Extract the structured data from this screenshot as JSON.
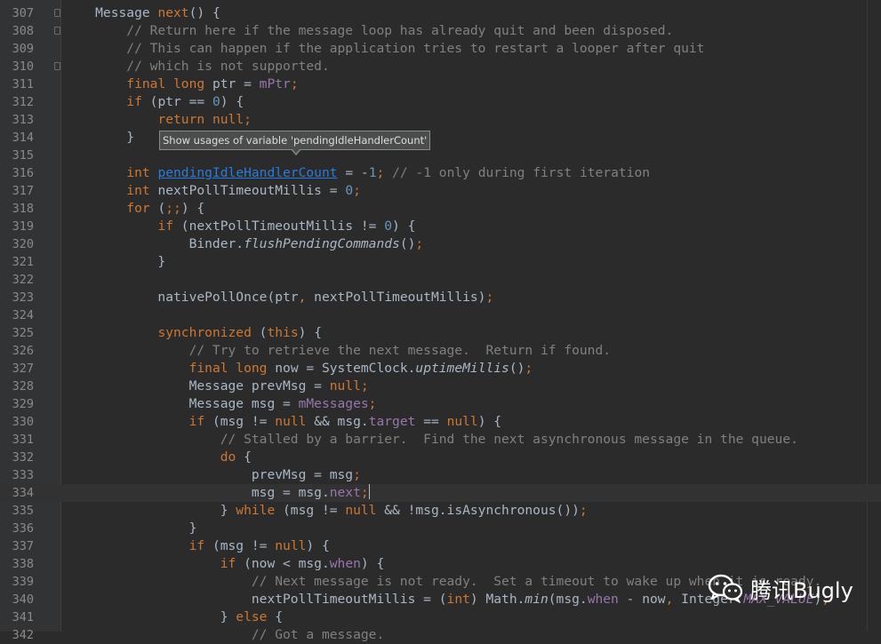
{
  "editor": {
    "lines": [
      {
        "num": "307",
        "fold": true,
        "tokens": [
          [
            "",
            "    Message "
          ],
          [
            "kw",
            "next"
          ],
          [
            "",
            "() {"
          ]
        ]
      },
      {
        "num": "308",
        "fold": true,
        "tokens": [
          [
            "cm",
            "        // Return here if the message loop has already quit and been disposed."
          ]
        ]
      },
      {
        "num": "309",
        "fold": false,
        "tokens": [
          [
            "cm",
            "        // This can happen if the application tries to restart a looper after quit"
          ]
        ]
      },
      {
        "num": "310",
        "fold": true,
        "tokens": [
          [
            "cm",
            "        // which is not supported."
          ]
        ]
      },
      {
        "num": "311",
        "fold": false,
        "tokens": [
          [
            "",
            "        "
          ],
          [
            "kw",
            "final long "
          ],
          [
            "",
            "ptr = "
          ],
          [
            "fld",
            "mPtr"
          ],
          [
            "kw",
            ";"
          ]
        ]
      },
      {
        "num": "312",
        "fold": false,
        "tokens": [
          [
            "",
            "        "
          ],
          [
            "kw",
            "if "
          ],
          [
            "",
            "(ptr == "
          ],
          [
            "nm",
            "0"
          ],
          [
            "",
            ") {"
          ]
        ]
      },
      {
        "num": "313",
        "fold": false,
        "tokens": [
          [
            "",
            "            "
          ],
          [
            "kw",
            "return null;"
          ]
        ]
      },
      {
        "num": "314",
        "fold": false,
        "tokens": [
          [
            "",
            "        }"
          ]
        ]
      },
      {
        "num": "315",
        "fold": false,
        "tokens": []
      },
      {
        "num": "316",
        "fold": false,
        "tokens": [
          [
            "",
            "        "
          ],
          [
            "kw",
            "int "
          ],
          [
            "link",
            "pendingIdleHandlerCount"
          ],
          [
            "",
            " = -"
          ],
          [
            "nm",
            "1"
          ],
          [
            "kw",
            "; "
          ],
          [
            "cm",
            "// -1 only during first iteration"
          ]
        ]
      },
      {
        "num": "317",
        "fold": false,
        "tokens": [
          [
            "",
            "        "
          ],
          [
            "kw",
            "int "
          ],
          [
            "",
            "nextPollTimeoutMillis = "
          ],
          [
            "nm",
            "0"
          ],
          [
            "kw",
            ";"
          ]
        ]
      },
      {
        "num": "318",
        "fold": false,
        "tokens": [
          [
            "",
            "        "
          ],
          [
            "kw",
            "for "
          ],
          [
            "",
            "("
          ],
          [
            "kw",
            ";;"
          ],
          [
            "",
            ") {"
          ]
        ]
      },
      {
        "num": "319",
        "fold": false,
        "tokens": [
          [
            "",
            "            "
          ],
          [
            "kw",
            "if "
          ],
          [
            "",
            "(nextPollTimeoutMillis != "
          ],
          [
            "nm",
            "0"
          ],
          [
            "",
            ") {"
          ]
        ]
      },
      {
        "num": "320",
        "fold": false,
        "tokens": [
          [
            "",
            "                Binder."
          ],
          [
            "it",
            "flushPendingCommands"
          ],
          [
            "",
            "()"
          ],
          [
            "kw",
            ";"
          ]
        ]
      },
      {
        "num": "321",
        "fold": false,
        "tokens": [
          [
            "",
            "            }"
          ]
        ]
      },
      {
        "num": "322",
        "fold": false,
        "tokens": []
      },
      {
        "num": "323",
        "fold": false,
        "tokens": [
          [
            "",
            "            nativePollOnce(ptr"
          ],
          [
            "kw",
            ", "
          ],
          [
            "",
            "nextPollTimeoutMillis)"
          ],
          [
            "kw",
            ";"
          ]
        ]
      },
      {
        "num": "324",
        "fold": false,
        "tokens": []
      },
      {
        "num": "325",
        "fold": false,
        "tokens": [
          [
            "",
            "            "
          ],
          [
            "kw",
            "synchronized "
          ],
          [
            "",
            "("
          ],
          [
            "kw",
            "this"
          ],
          [
            "",
            ") {"
          ]
        ]
      },
      {
        "num": "326",
        "fold": false,
        "tokens": [
          [
            "cm",
            "                // Try to retrieve the next message.  Return if found."
          ]
        ]
      },
      {
        "num": "327",
        "fold": false,
        "tokens": [
          [
            "",
            "                "
          ],
          [
            "kw",
            "final long "
          ],
          [
            "",
            "now = SystemClock."
          ],
          [
            "it",
            "uptimeMillis"
          ],
          [
            "",
            "()"
          ],
          [
            "kw",
            ";"
          ]
        ]
      },
      {
        "num": "328",
        "fold": false,
        "tokens": [
          [
            "",
            "                Message prevMsg = "
          ],
          [
            "kw",
            "null;"
          ]
        ]
      },
      {
        "num": "329",
        "fold": false,
        "tokens": [
          [
            "",
            "                Message msg = "
          ],
          [
            "fld",
            "mMessages"
          ],
          [
            "kw",
            ";"
          ]
        ]
      },
      {
        "num": "330",
        "fold": false,
        "tokens": [
          [
            "",
            "                "
          ],
          [
            "kw",
            "if "
          ],
          [
            "",
            "(msg != "
          ],
          [
            "kw",
            "null "
          ],
          [
            "",
            "&& msg."
          ],
          [
            "fld",
            "target "
          ],
          [
            "",
            "== "
          ],
          [
            "kw",
            "null"
          ],
          [
            "",
            ") {"
          ]
        ]
      },
      {
        "num": "331",
        "fold": false,
        "tokens": [
          [
            "cm",
            "                    // Stalled by a barrier.  Find the next asynchronous message in the queue."
          ]
        ]
      },
      {
        "num": "332",
        "fold": false,
        "tokens": [
          [
            "",
            "                    "
          ],
          [
            "kw",
            "do "
          ],
          [
            "",
            "{"
          ]
        ]
      },
      {
        "num": "333",
        "fold": false,
        "tokens": [
          [
            "",
            "                        prevMsg = msg"
          ],
          [
            "kw",
            ";"
          ]
        ]
      },
      {
        "num": "334",
        "fold": false,
        "current": true,
        "tokens": [
          [
            "",
            "                        msg = msg."
          ],
          [
            "fld",
            "next"
          ],
          [
            "kw",
            ";"
          ],
          [
            "caret",
            ""
          ]
        ]
      },
      {
        "num": "335",
        "fold": false,
        "tokens": [
          [
            "",
            "                    } "
          ],
          [
            "kw",
            "while "
          ],
          [
            "",
            "(msg != "
          ],
          [
            "kw",
            "null "
          ],
          [
            "",
            "&& !msg.isAsynchronous())"
          ],
          [
            "kw",
            ";"
          ]
        ]
      },
      {
        "num": "336",
        "fold": false,
        "tokens": [
          [
            "",
            "                }"
          ]
        ]
      },
      {
        "num": "337",
        "fold": false,
        "tokens": [
          [
            "",
            "                "
          ],
          [
            "kw",
            "if "
          ],
          [
            "",
            "(msg != "
          ],
          [
            "kw",
            "null"
          ],
          [
            "",
            ") {"
          ]
        ]
      },
      {
        "num": "338",
        "fold": false,
        "tokens": [
          [
            "",
            "                    "
          ],
          [
            "kw",
            "if "
          ],
          [
            "",
            "(now < msg."
          ],
          [
            "fld",
            "when"
          ],
          [
            "",
            ") {"
          ]
        ]
      },
      {
        "num": "339",
        "fold": false,
        "tokens": [
          [
            "cm",
            "                        // Next message is not ready.  Set a timeout to wake up when it is ready."
          ]
        ]
      },
      {
        "num": "340",
        "fold": false,
        "tokens": [
          [
            "",
            "                        nextPollTimeoutMillis = ("
          ],
          [
            "kw",
            "int"
          ],
          [
            "",
            ") Math."
          ],
          [
            "it",
            "min"
          ],
          [
            "",
            "(msg."
          ],
          [
            "fld",
            "when "
          ],
          [
            "",
            "- now"
          ],
          [
            "kw",
            ", "
          ],
          [
            "",
            "Integer."
          ],
          [
            "fi",
            "MAX_VALUE"
          ],
          [
            "",
            ")"
          ],
          [
            "kw",
            ";"
          ]
        ]
      },
      {
        "num": "341",
        "fold": false,
        "tokens": [
          [
            "",
            "                    } "
          ],
          [
            "kw",
            "else "
          ],
          [
            "",
            "{"
          ]
        ]
      },
      {
        "num": "342",
        "fold": false,
        "tokens": [
          [
            "cm",
            "                        // Got a message."
          ]
        ]
      }
    ]
  },
  "tooltip": {
    "text": "Show usages of variable 'pendingIdleHandlerCount'"
  },
  "watermark": {
    "text": "腾讯Bugly",
    "icon": "wechat-icon"
  },
  "colors": {
    "background": "#2b2b2b",
    "gutter": "#313335",
    "keyword": "#cc7832",
    "comment": "#808080",
    "number": "#6897bb",
    "field": "#9876aa",
    "link": "#287bde",
    "text": "#a9b7c6"
  }
}
